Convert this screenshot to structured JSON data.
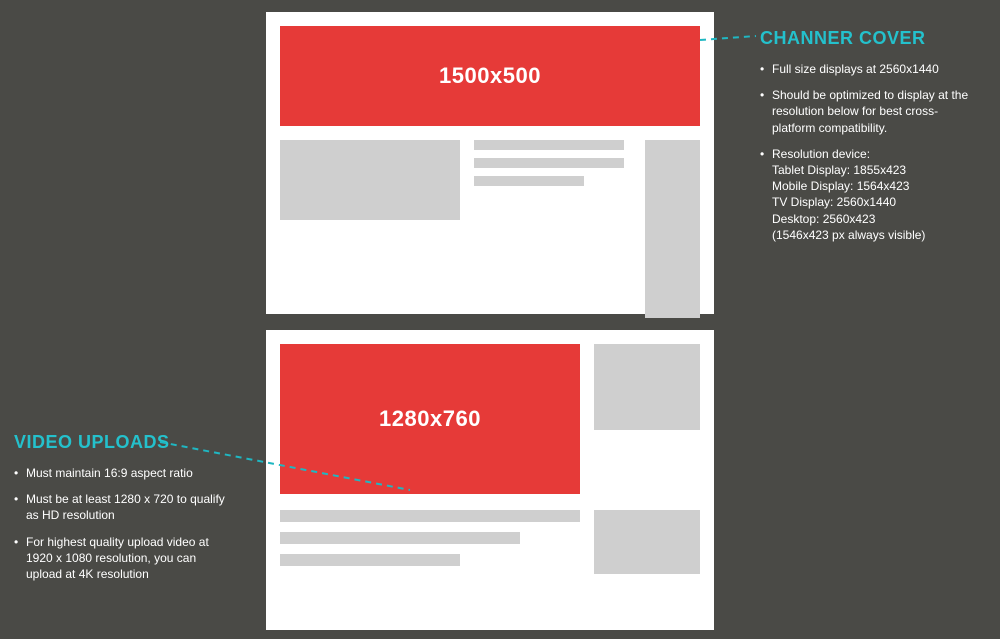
{
  "colors": {
    "accent": "#e63a38",
    "teal": "#24c1cc",
    "bg": "#4a4a46"
  },
  "top": {
    "banner_label": "1500x500"
  },
  "bottom": {
    "banner_label": "1280x760"
  },
  "anno_right": {
    "title": "CHANNER COVER",
    "bullet1": "Full size displays at 2560x1440",
    "bullet2": "Should be optimized to display at the resolution below for best cross-platform compatibility.",
    "bullet3_intro": "Resolution device:",
    "res_tablet": "Tablet Display: 1855x423",
    "res_mobile": "Mobile Display: 1564x423",
    "res_tv": "TV Display: 2560x1440",
    "res_desktop": "Desktop: 2560x423",
    "res_note": "(1546x423 px always visible)"
  },
  "anno_left": {
    "title": "VIDEO UPLOADS",
    "bullet1": "Must maintain 16:9 aspect ratio",
    "bullet2": "Must be at least 1280 x 720 to qualify as HD resolution",
    "bullet3": "For highest quality upload video at 1920 x 1080 resolution, you can upload at 4K resolution"
  }
}
